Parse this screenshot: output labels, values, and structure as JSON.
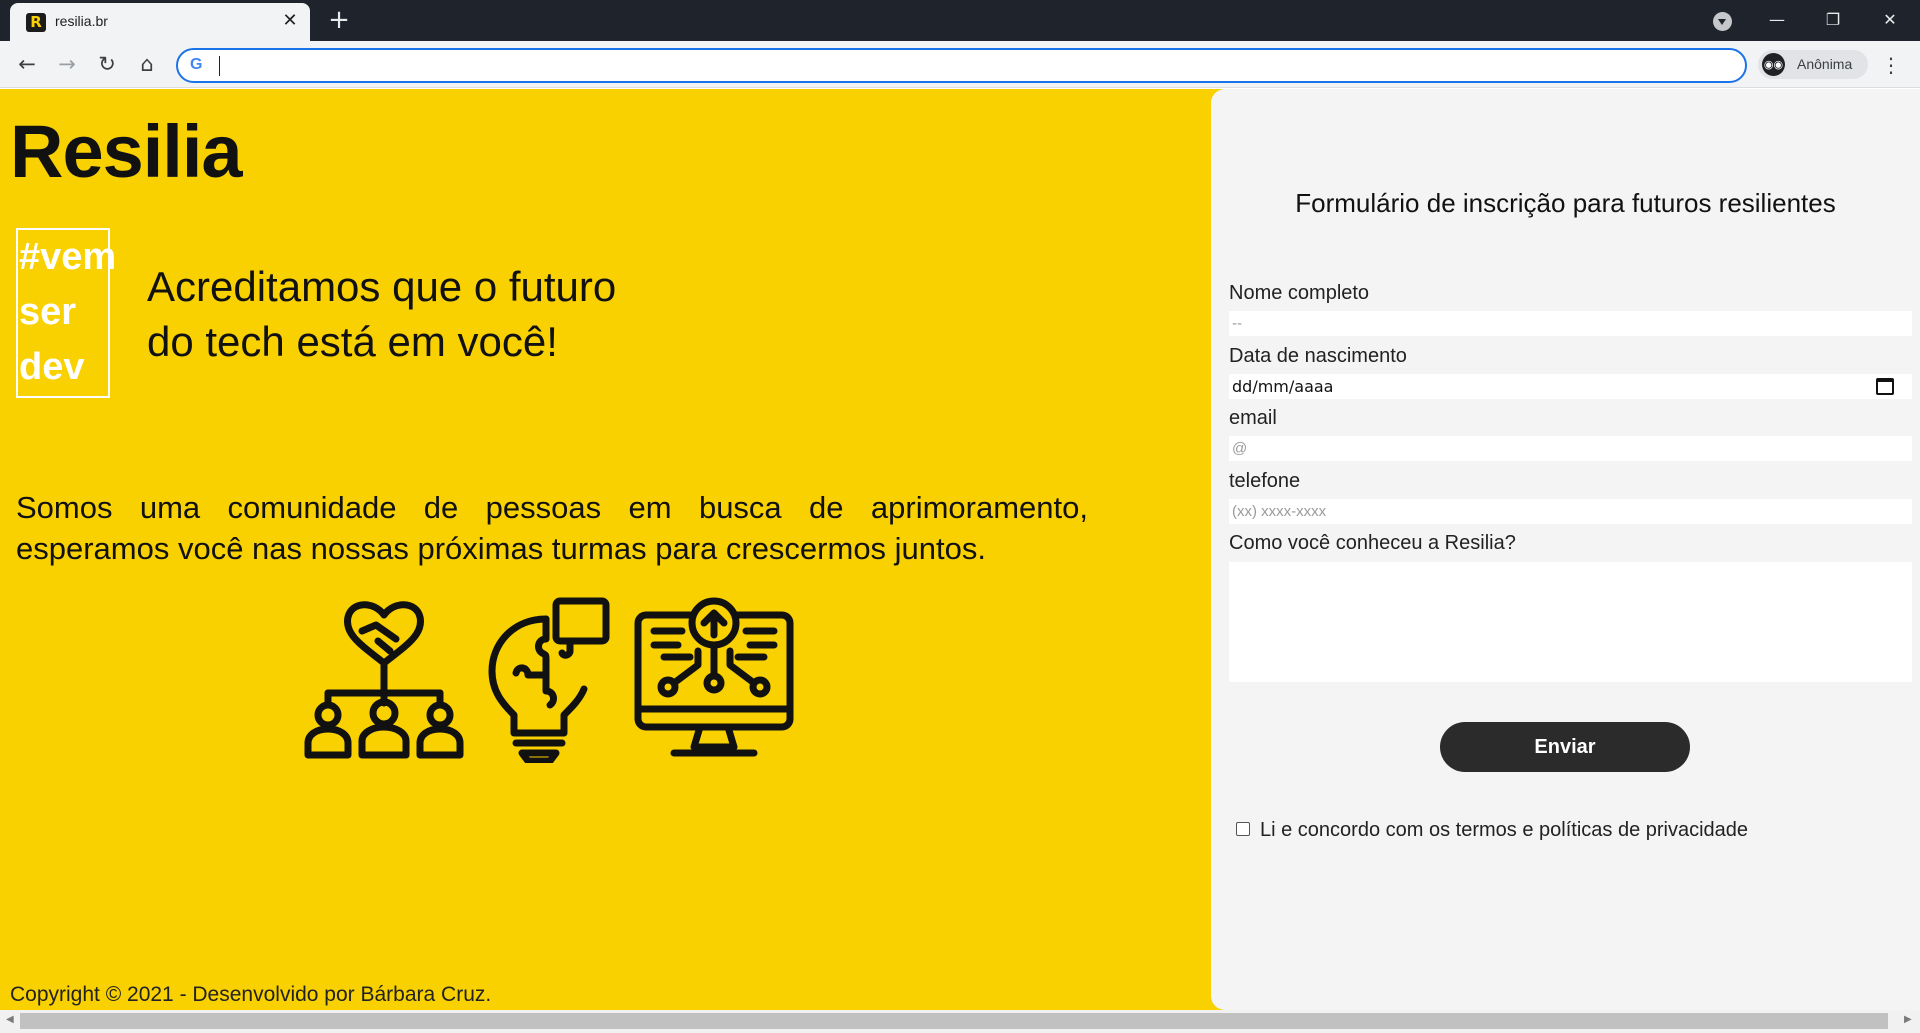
{
  "browser": {
    "tab_title": "resilia.br",
    "tab_favicon_letter": "R",
    "tab_close": "✕",
    "new_tab": "+",
    "window_minimize": "—",
    "window_restore": "❐",
    "window_close": "✕",
    "back": "←",
    "forward": "→",
    "reload": "↻",
    "home": "⌂",
    "omnibox_google_letter": "G",
    "omnibox_value": "",
    "profile_label": "Anônima",
    "incognito_icon": "incognito-icon",
    "menu": "⋮"
  },
  "hero": {
    "brand": "Resilia",
    "hashtag_lines": [
      "#vem",
      "ser",
      "dev"
    ],
    "tagline_lines": [
      "Acreditamos que o futuro",
      "do tech está em você!"
    ],
    "about": "Somos uma comunidade de pessoas em busca de aprimoramento, esperamos você nas nossas próximas turmas para crescermos juntos.",
    "icons": [
      "teamwork-handshake-icon",
      "lightbulb-puzzle-icon",
      "computer-upload-circuit-icon"
    ]
  },
  "form": {
    "title": "Formulário de inscrição para futuros resilientes",
    "name_label": "Nome completo",
    "name_placeholder": "--",
    "birth_label": "Data de nascimento",
    "birth_placeholder": "dd/mm/aaaa",
    "email_label": "email",
    "email_placeholder": "@",
    "phone_label": "telefone",
    "phone_placeholder": "(xx) xxxx-xxxx",
    "source_label": "Como você conheceu a Resilia?",
    "submit_label": "Enviar",
    "terms_label": "Li e concordo com os termos e políticas de privacidade",
    "terms_checked": false
  },
  "footer": {
    "copyright": "Copyright © 2021 - Desenvolvido por Bárbara Cruz."
  }
}
